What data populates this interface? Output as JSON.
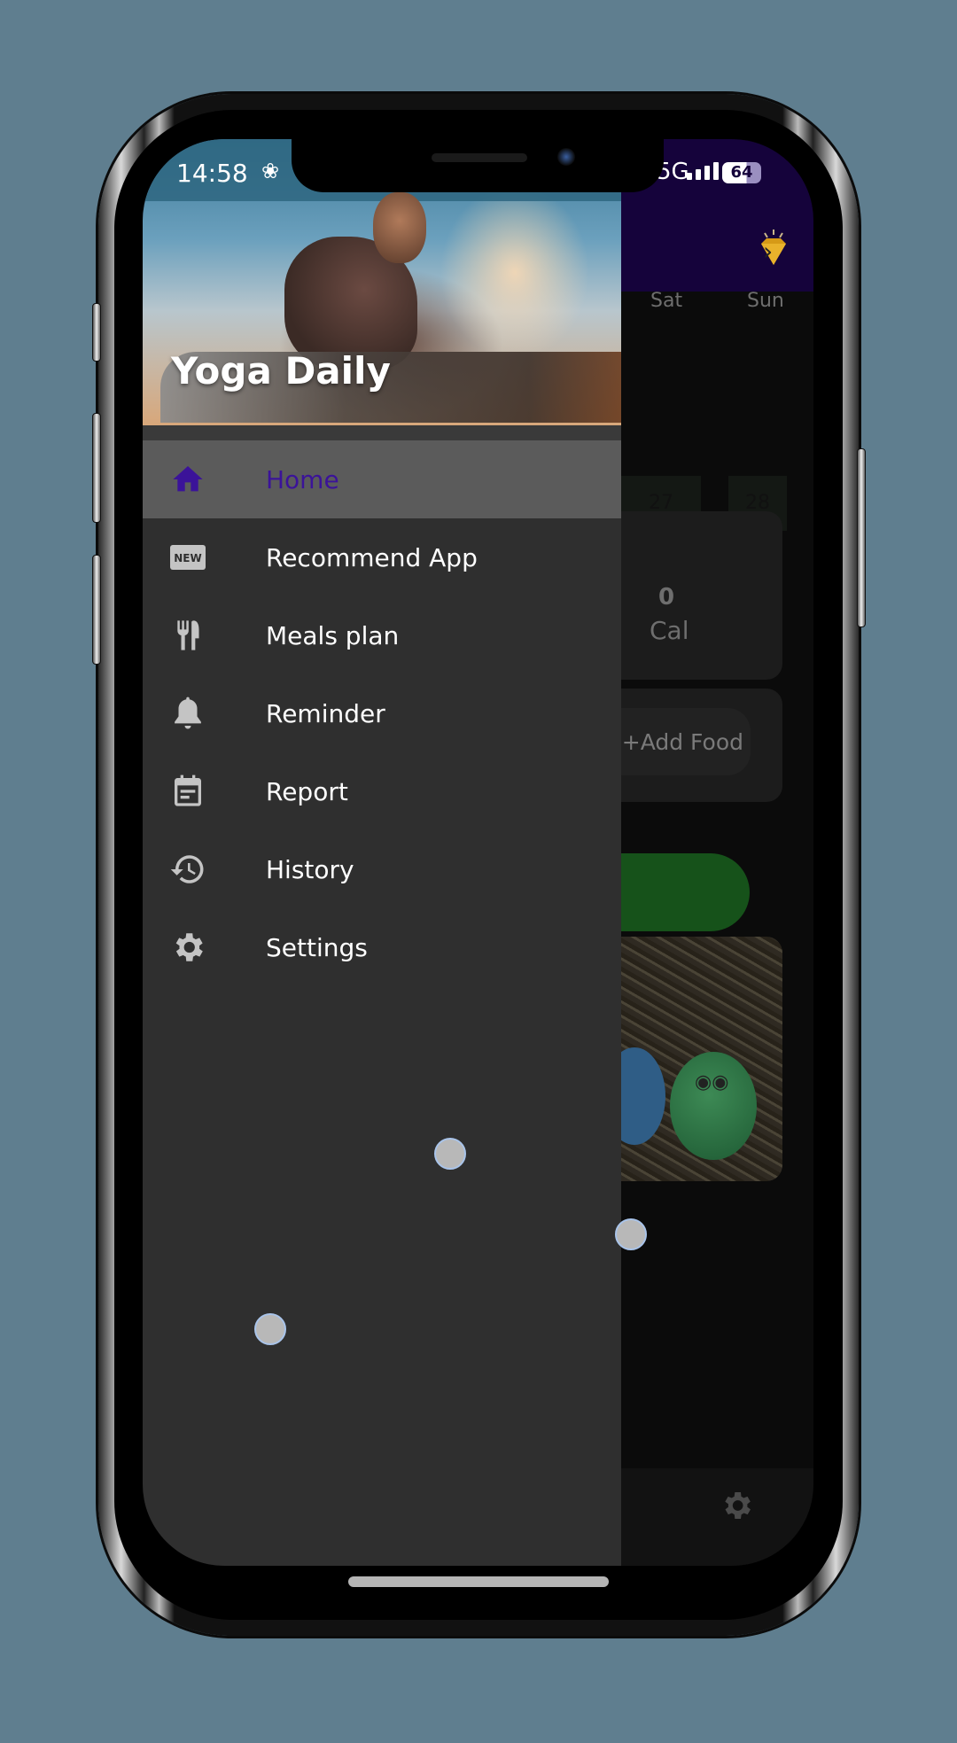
{
  "status_bar": {
    "time": "14:58",
    "network": "5G",
    "battery": "64"
  },
  "drawer": {
    "app_title": "Yoga Daily",
    "items": [
      {
        "label": "Home",
        "icon": "home-icon",
        "active": true
      },
      {
        "label": "Recommend App",
        "icon": "new-badge-icon",
        "active": false
      },
      {
        "label": "Meals plan",
        "icon": "fork-knife-icon",
        "active": false
      },
      {
        "label": "Reminder",
        "icon": "bell-icon",
        "active": false
      },
      {
        "label": "Report",
        "icon": "calendar-report-icon",
        "active": false
      },
      {
        "label": "History",
        "icon": "history-icon",
        "active": false
      },
      {
        "label": "Settings",
        "icon": "gear-icon",
        "active": false
      }
    ]
  },
  "background_screen": {
    "header_icon": "diamond-premium-icon",
    "week": [
      {
        "day": "Sat",
        "date": "27"
      },
      {
        "day": "Sun",
        "date": "28"
      }
    ],
    "calories": {
      "value": "0",
      "unit": "Cal"
    },
    "add_food_label": "+Add Food",
    "bottom_nav_icon": "gear-icon"
  },
  "colors": {
    "header": "#15033b",
    "active_accent": "#3b1399",
    "drawer_bg": "#2f2f2f",
    "active_row": "#5b5b5b",
    "green_button": "#16521a"
  }
}
